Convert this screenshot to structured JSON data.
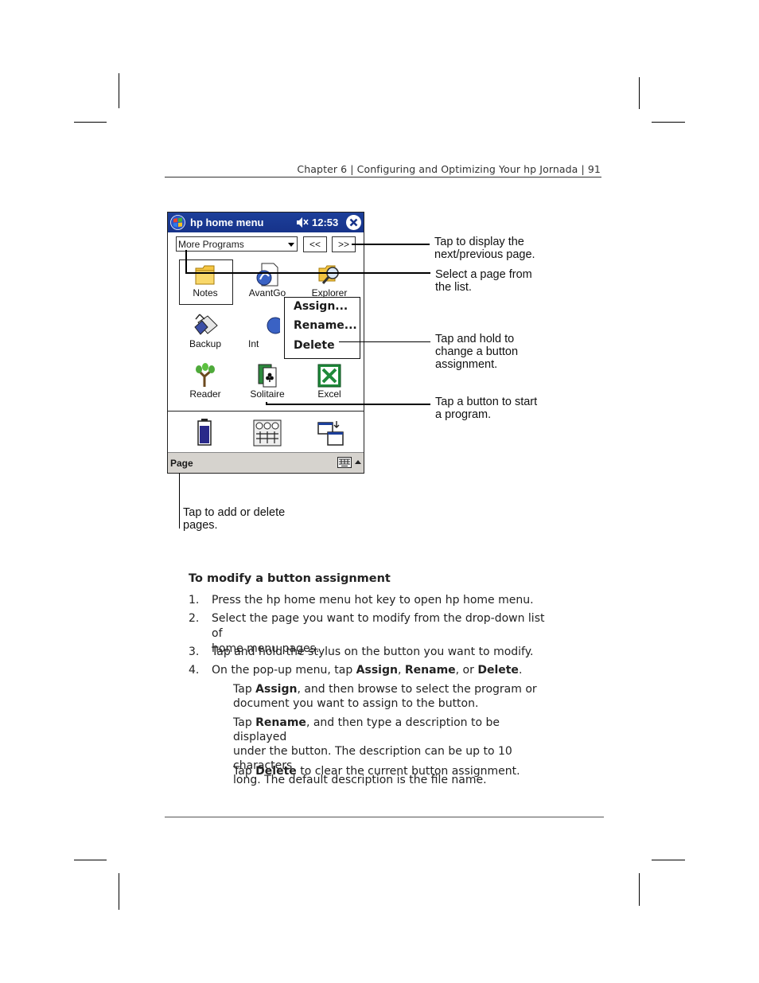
{
  "header": {
    "running_head": "Chapter 6 | Configuring and Optimizing Your hp Jornada | 91"
  },
  "device": {
    "title": "hp home menu",
    "time": "12:53",
    "dropdown_value": "More Programs",
    "prev_label": "<<",
    "next_label": ">>",
    "apps": {
      "notes": "Notes",
      "avantgo": "AvantGo",
      "explorer": "Explorer",
      "backup": "Backup",
      "internet": "Int",
      "reader": "Reader",
      "solitaire": "Solitaire",
      "excel": "Excel"
    },
    "popup": {
      "assign": "Assign...",
      "rename": "Rename...",
      "delete": "Delete"
    },
    "menubar_label": "Page",
    "icons": [
      "windows-flag-icon",
      "speaker-icon",
      "close-icon",
      "battery-icon",
      "keyboard-icon",
      "switch-window-icon"
    ]
  },
  "callouts": {
    "nav": [
      "Tap to display the",
      "next/previous page."
    ],
    "select": [
      "Select a page from",
      "the list."
    ],
    "hold": [
      "Tap and hold to",
      "change a button",
      "assignment."
    ],
    "start": [
      "Tap a button to start",
      "a program."
    ],
    "pages": [
      "Tap to add or delete",
      "pages."
    ]
  },
  "procedure": {
    "title": "To modify a button assignment",
    "steps": [
      {
        "num": "1.",
        "line1": "Press the hp home menu hot key to open hp home menu."
      },
      {
        "num": "2.",
        "line1": "Select the page you want to modify from the drop-down list of",
        "line2": "home menu pages."
      },
      {
        "num": "3.",
        "line1": "Tap and hold the stylus on the button you want to modify."
      },
      {
        "num": "4.",
        "pre": "On the pop-up menu, tap ",
        "b1": "Assign",
        "sep1": ", ",
        "b2": "Rename",
        "sep2": ", or ",
        "b3": "Delete",
        "end": "."
      }
    ],
    "details": {
      "assign": {
        "tap": "Tap ",
        "word": "Assign",
        "rest1": ", and then browse to select the program or",
        "line2": "document you want to assign to the button."
      },
      "rename": {
        "tap": "Tap ",
        "word": "Rename",
        "rest1": ", and then type a description to be displayed",
        "line2": "under the button. The description can be up to 10 characters",
        "line3": "long. The default description is the file name."
      },
      "delete": {
        "tap": "Tap ",
        "word": "Delete",
        "rest1": " to clear the current button assignment."
      }
    }
  }
}
